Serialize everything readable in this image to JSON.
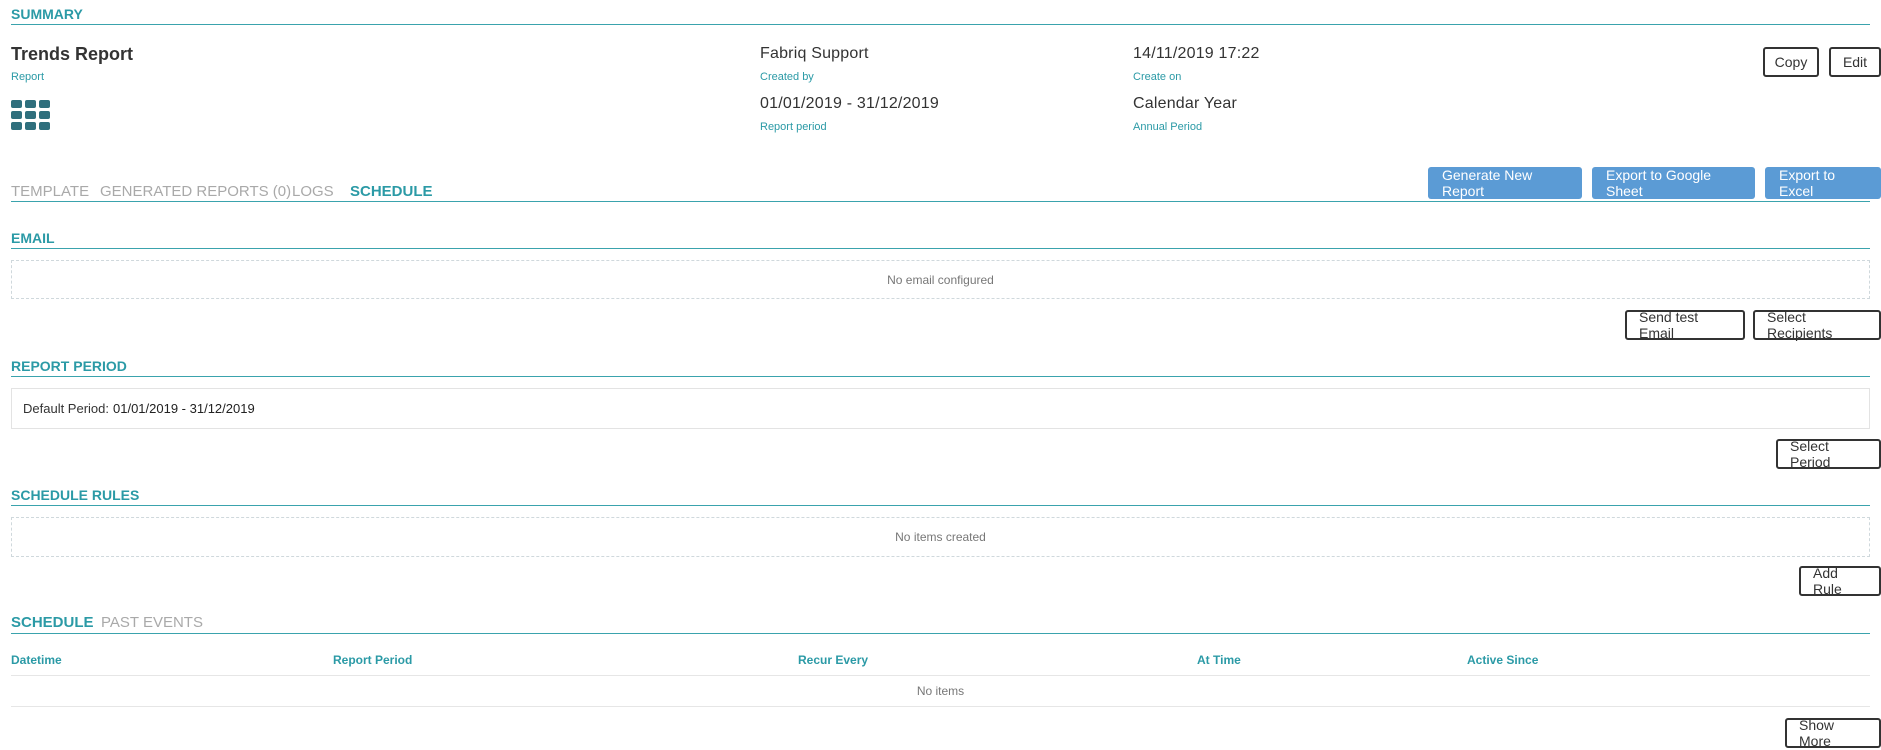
{
  "summary": {
    "heading": "SUMMARY",
    "report_name": "Trends Report",
    "report_type_label": "Report",
    "created_by_value": "Fabriq Support",
    "created_by_label": "Created by",
    "report_period_value": "01/01/2019 - 31/12/2019",
    "report_period_label": "Report period",
    "created_on_value": "14/11/2019 17:22",
    "created_on_label": "Create on",
    "annual_period_value": "Calendar Year",
    "annual_period_label": "Annual Period",
    "copy_label": "Copy",
    "edit_label": "Edit",
    "icon": "grid-icon"
  },
  "tabs": [
    {
      "label": "TEMPLATE",
      "active": false
    },
    {
      "label": "GENERATED REPORTS (0)",
      "active": false
    },
    {
      "label": "LOGS",
      "active": false
    },
    {
      "label": "SCHEDULE",
      "active": true
    }
  ],
  "actions": {
    "generate_label": "Generate New Report",
    "export_google_label": "Export to Google Sheet",
    "export_excel_label": "Export to Excel"
  },
  "email": {
    "heading": "EMAIL",
    "empty_text": "No email configured",
    "send_test_label": "Send test Email",
    "select_recipients_label": "Select Recipients"
  },
  "report_period": {
    "heading": "REPORT PERIOD",
    "default_label": "Default Period:",
    "default_value": "01/01/2019 - 31/12/2019",
    "select_period_label": "Select Period"
  },
  "schedule_rules": {
    "heading": "SCHEDULE RULES",
    "empty_text": "No items created",
    "add_rule_label": "Add Rule"
  },
  "schedule": {
    "tabs": [
      {
        "label": "SCHEDULE",
        "active": true
      },
      {
        "label": "PAST EVENTS",
        "active": false
      }
    ],
    "columns": [
      "Datetime",
      "Report Period",
      "Recur Every",
      "At Time",
      "Active Since"
    ],
    "empty_text": "No items",
    "show_more_label": "Show More"
  },
  "colors": {
    "accent": "#2b9aa6",
    "button_blue": "#5b9bd5",
    "tab_inactive": "#a9a9a9"
  }
}
